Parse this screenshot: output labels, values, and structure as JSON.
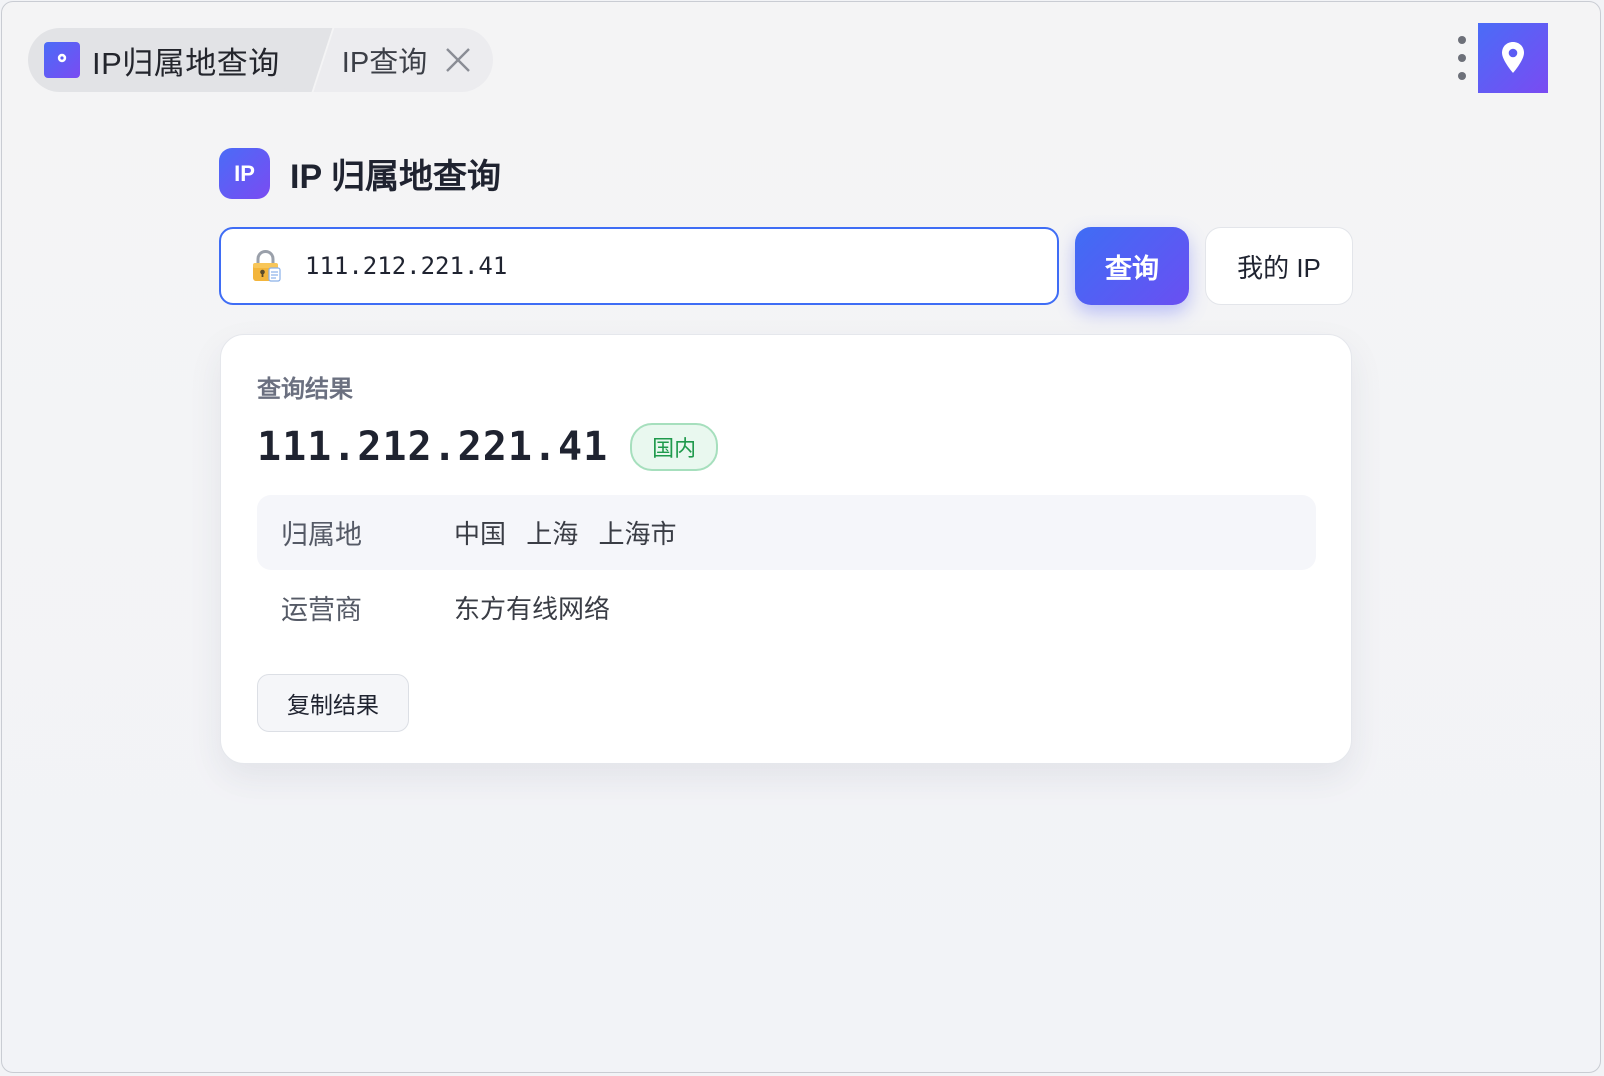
{
  "tabs": {
    "app_title": "IP归属地查询",
    "doc_title": "IP查询"
  },
  "header": {
    "logo_text": "IP",
    "title": "IP 归属地查询"
  },
  "search": {
    "value": "111.212.221.41",
    "query_button": "查询",
    "my_ip_button": "我的 IP"
  },
  "result": {
    "section_label": "查询结果",
    "ip": "111.212.221.41",
    "region_badge": "国内",
    "rows": [
      {
        "key": "归属地",
        "value": "中国 上海 上海市"
      },
      {
        "key": "运营商",
        "value": "东方有线网络"
      }
    ],
    "copy_button": "复制结果"
  },
  "colors": {
    "accent_start": "#4a6cf7",
    "accent_end": "#7a4bf2",
    "badge_green": "#1f9a4c"
  },
  "icons": {
    "app": "location-pin-icon",
    "close": "close-icon",
    "more": "more-vertical-icon",
    "corner": "location-pin-icon",
    "input": "lock-icon"
  }
}
